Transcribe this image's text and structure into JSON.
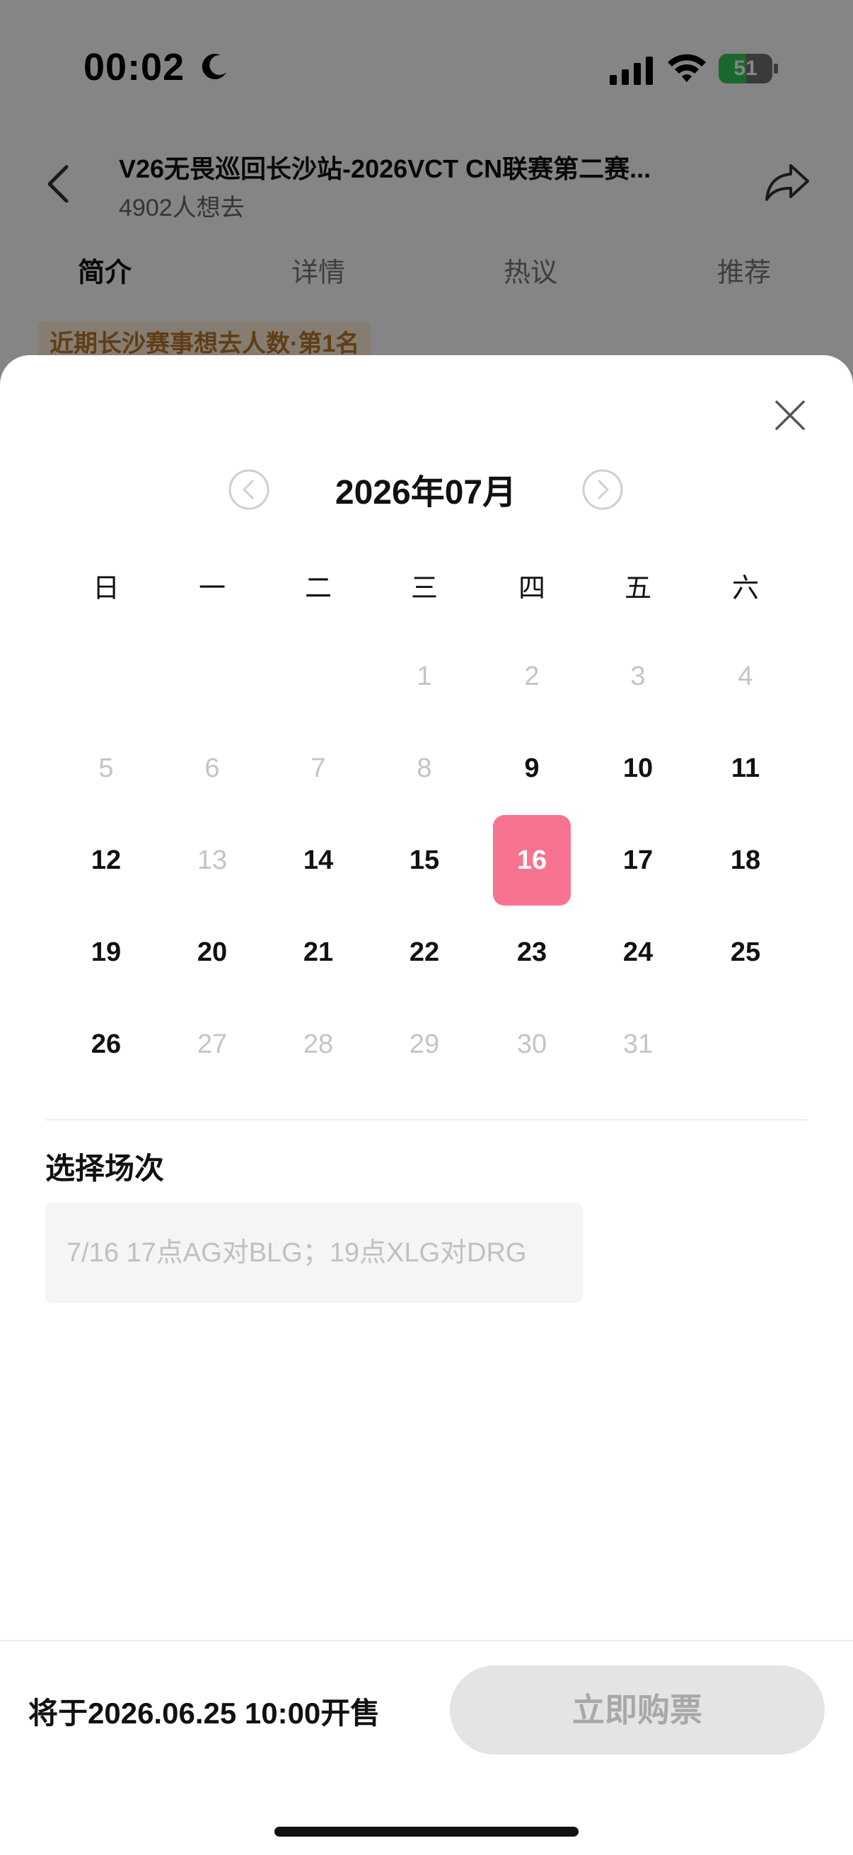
{
  "status_bar": {
    "time": "00:02",
    "battery_text": "51",
    "battery_level": 0.51,
    "icons": [
      "moon-icon",
      "cellular-signal-icon",
      "wifi-icon",
      "battery-icon"
    ]
  },
  "header": {
    "title": "V26无畏巡回长沙站-2026VCT CN联赛第二赛...",
    "subtitle": "4902人想去"
  },
  "tabs": [
    {
      "label": "简介",
      "active": true
    },
    {
      "label": "详情",
      "active": false
    },
    {
      "label": "热议",
      "active": false
    },
    {
      "label": "推荐",
      "active": false
    }
  ],
  "banner": {
    "text": "近期长沙赛事想去人数·第1名"
  },
  "calendar": {
    "month_label": "2026年07月",
    "weekdays": [
      "日",
      "一",
      "二",
      "三",
      "四",
      "五",
      "六"
    ],
    "first_weekday_index": 3,
    "days_in_month": 31,
    "available_days": [
      9,
      10,
      11,
      12,
      14,
      15,
      16,
      17,
      18,
      19,
      20,
      21,
      22,
      23,
      24,
      25,
      26
    ],
    "selected_day": 16
  },
  "session": {
    "label": "选择场次",
    "chip_text": "7/16 17点AG对BLG；19点XLG对DRG"
  },
  "bottom_bar": {
    "sale_text": "将于2026.06.25 10:00开售",
    "buy_label": "立即购票"
  },
  "colors": {
    "selected_day_bg": "#f7738f",
    "banner_text": "#b8752b",
    "battery_green": "#34c759"
  }
}
